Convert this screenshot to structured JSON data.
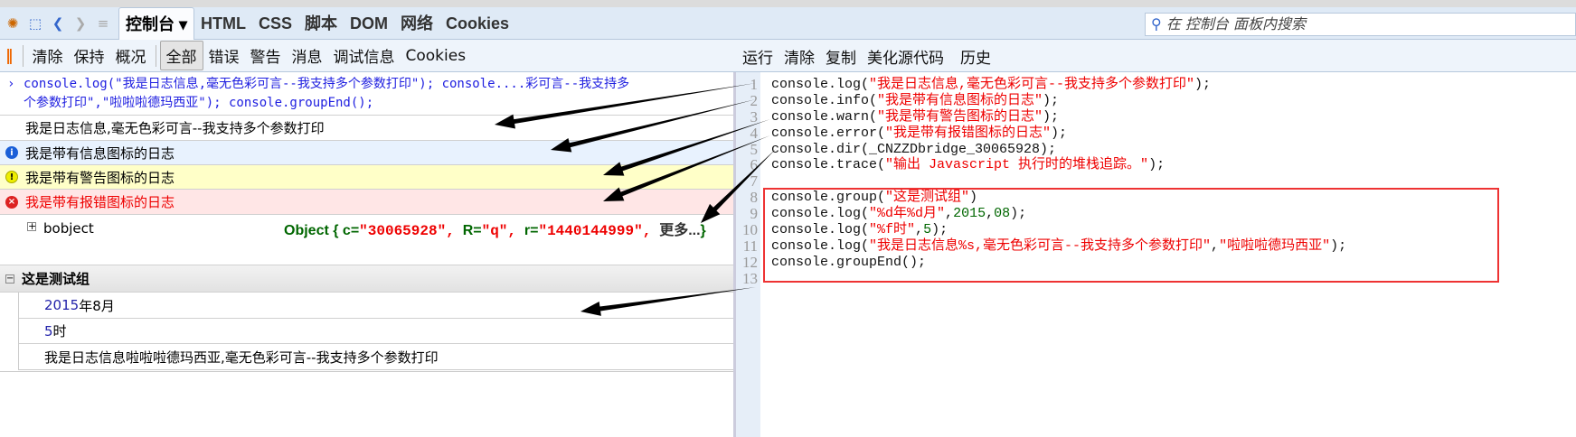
{
  "tabs": [
    "控制台",
    "HTML",
    "CSS",
    "脚本",
    "DOM",
    "网络",
    "Cookies"
  ],
  "search_placeholder": "在 控制台 面板内搜索",
  "toolbar": {
    "left": [
      "清除",
      "保持",
      "概况"
    ],
    "filters": [
      "全部",
      "错误",
      "警告",
      "消息",
      "调试信息",
      "Cookies"
    ],
    "right": [
      "运行",
      "清除",
      "复制",
      "美化源代码",
      "历史"
    ]
  },
  "console": {
    "command": [
      "console.log(\"我是日志信息,毫无色彩可言--我支持多个参数打印\"); console....彩可言--我支持多",
      "个参数打印\",\"啦啦啦德玛西亚\"); console.groupEnd();"
    ],
    "log": "我是日志信息,毫无色彩可言--我支持多个参数打印",
    "info": "我是带有信息图标的日志",
    "warn": "我是带有警告图标的日志",
    "error": "我是带有报错图标的日志",
    "dir_name": "bobject",
    "dir_value": {
      "prefix": "Object {",
      "c_key": "c=",
      "c_val": "\"30065928\",",
      "R_key": "R=",
      "R_val": "\"q\",",
      "r_key": "r=",
      "r_val": "\"1440144999\",",
      "more": "更多...",
      "suffix": "}"
    },
    "group_title": "这是测试组",
    "group_items": [
      {
        "num": "2015",
        "text": "年8月"
      },
      {
        "num": "5",
        "text": "时"
      },
      {
        "num": "",
        "text": "我是日志信息啦啦啦德玛西亚,毫无色彩可言--我支持多个参数打印"
      }
    ]
  },
  "line_numbers": [
    "1",
    "2",
    "3",
    "4",
    "5",
    "6",
    "7",
    "8",
    "9",
    "10",
    "11",
    "12",
    "13"
  ],
  "code": [
    [
      [
        "p",
        "console.log("
      ],
      [
        "s",
        "\"我是日志信息,毫无色彩可言--我支持多个参数打印\""
      ],
      [
        "p",
        ");"
      ]
    ],
    [
      [
        "p",
        "console.info("
      ],
      [
        "s",
        "\"我是带有信息图标的日志\""
      ],
      [
        "p",
        ");"
      ]
    ],
    [
      [
        "p",
        "console.warn("
      ],
      [
        "s",
        "\"我是带有警告图标的日志\""
      ],
      [
        "p",
        ");"
      ]
    ],
    [
      [
        "p",
        "console.error("
      ],
      [
        "s",
        "\"我是带有报错图标的日志\""
      ],
      [
        "p",
        ");"
      ]
    ],
    [
      [
        "p",
        "console.dir(_CNZZDbridge_30065928);"
      ]
    ],
    [
      [
        "p",
        "console.trace("
      ],
      [
        "s",
        "\"输出 Javascript 执行时的堆栈追踪。\""
      ],
      [
        "p",
        ");"
      ]
    ],
    [],
    [
      [
        "p",
        "console.group("
      ],
      [
        "s",
        "\"这是测试组\""
      ],
      [
        "p",
        ")"
      ]
    ],
    [
      [
        "p",
        "console.log("
      ],
      [
        "s",
        "\"%d年%d月\""
      ],
      [
        "p",
        ","
      ],
      [
        "n",
        "2015"
      ],
      [
        "p",
        ","
      ],
      [
        "n",
        "08"
      ],
      [
        "p",
        ");"
      ]
    ],
    [
      [
        "p",
        "console.log("
      ],
      [
        "s",
        "\"%f时\""
      ],
      [
        "p",
        ","
      ],
      [
        "n",
        "5"
      ],
      [
        "p",
        ");"
      ]
    ],
    [
      [
        "p",
        "console.log("
      ],
      [
        "s",
        "\"我是日志信息%s,毫无色彩可言--我支持多个参数打印\""
      ],
      [
        "p",
        ","
      ],
      [
        "s",
        "\"啦啦啦德玛西亚\""
      ],
      [
        "p",
        ");"
      ]
    ],
    [
      [
        "p",
        "console.groupEnd();"
      ]
    ],
    []
  ]
}
